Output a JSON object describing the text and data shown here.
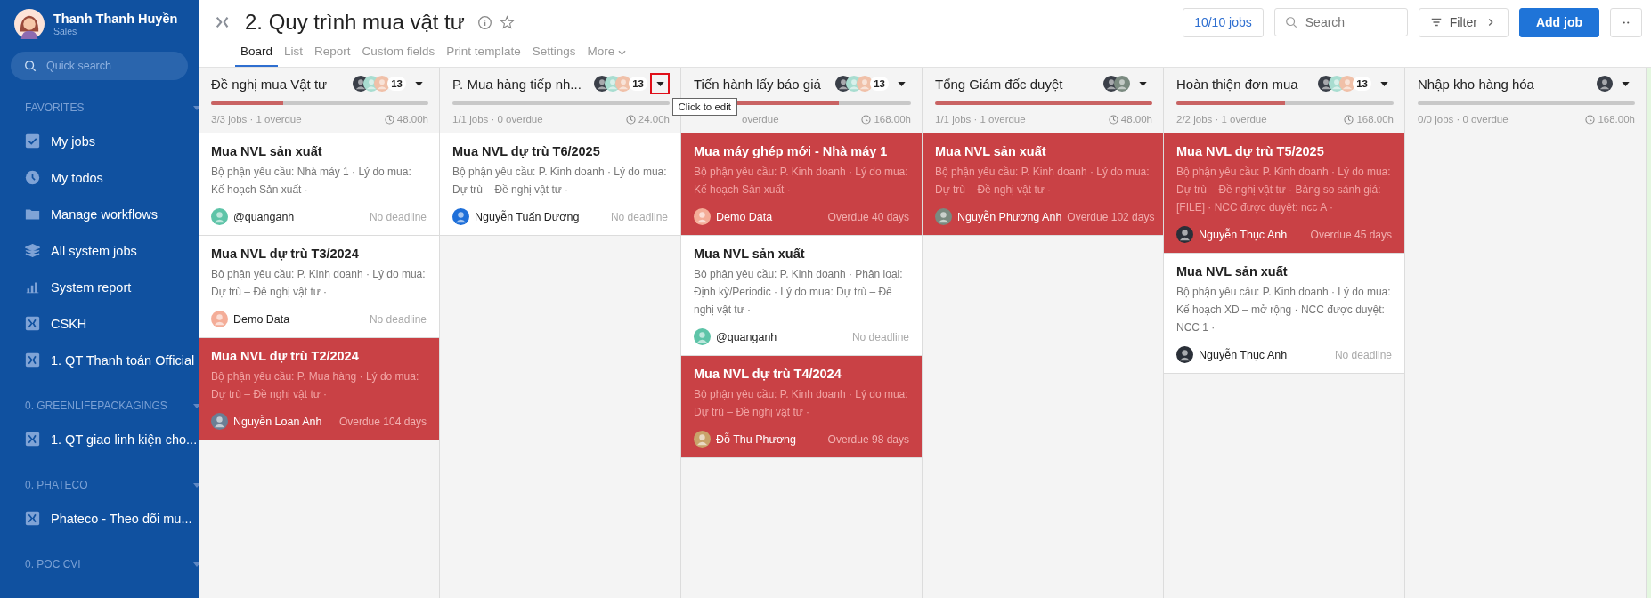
{
  "user": {
    "name": "Thanh Thanh Huyền",
    "role": "Sales"
  },
  "sidebar": {
    "search_placeholder": "Quick search",
    "sections": [
      {
        "title": "FAVORITES",
        "items": [
          {
            "label": "My jobs",
            "kind": "check"
          },
          {
            "label": "My todos",
            "kind": "clock"
          },
          {
            "label": "Manage workflows",
            "kind": "folder"
          },
          {
            "label": "All system jobs",
            "kind": "layers"
          },
          {
            "label": "System report",
            "kind": "chart"
          },
          {
            "label": "CSKH",
            "kind": "workflow"
          },
          {
            "label": "1. QT Thanh toán Official",
            "kind": "workflow"
          }
        ]
      },
      {
        "title": "0. GREENLIFEPACKAGINGS",
        "items": [
          {
            "label": "1. QT giao linh kiện cho...",
            "kind": "workflow"
          }
        ]
      },
      {
        "title": "0. PHATECO",
        "items": [
          {
            "label": "Phateco - Theo dõi mu...",
            "kind": "workflow"
          }
        ]
      },
      {
        "title": "0. POC CVI"
      }
    ]
  },
  "header": {
    "title": "2. Quy trình mua vật tư",
    "tabs": [
      {
        "label": "Board",
        "selected": true
      },
      {
        "label": "List",
        "selected": false
      },
      {
        "label": "Report",
        "selected": false
      },
      {
        "label": "Custom fields",
        "selected": false
      },
      {
        "label": "Print template",
        "selected": false
      },
      {
        "label": "Settings",
        "selected": false
      },
      {
        "label": "More",
        "selected": false
      }
    ],
    "job_count": "10/10 jobs",
    "search_placeholder": "Search",
    "filter": "Filter",
    "add": "Add job"
  },
  "tooltip": "Click to edit",
  "columns": [
    {
      "title": "Đề nghị mua Vật tư",
      "members": [
        {
          "color": "#3a3f48"
        },
        {
          "color": "#a8ddd0"
        },
        {
          "color": "#f0c0a8"
        }
      ],
      "count": "13",
      "highlighted": false,
      "level": 0.33,
      "stats": "3/3 jobs · 1 overdue",
      "hours": "48.00h",
      "cards": [
        {
          "title": "Mua NVL sản xuất",
          "desc": "Bộ phận yêu cầu: Nhà máy 1 · Lý do mua: Kế hoạch Sản xuất ·",
          "assignee": "@quanganh",
          "color": "#5ec4a8",
          "due": "No deadline",
          "overdue": false
        },
        {
          "title": "Mua NVL dự trù T3/2024",
          "desc": "Bộ phận yêu cầu: P. Kinh doanh · Lý do mua: Dự trù – Đề nghị vật tư ·",
          "assignee": "Demo Data",
          "color": "#f4ad98",
          "due": "No deadline",
          "overdue": false
        },
        {
          "title": "Mua NVL dự trù T2/2024",
          "desc": "Bộ phận yêu cầu: P. Mua hàng · Lý do mua: Dự trù – Đề nghị vật tư ·",
          "assignee": "Nguyễn Loan Anh",
          "color": "#6b7f95",
          "due": "Overdue 104 days",
          "overdue": true
        }
      ]
    },
    {
      "title": "P. Mua hàng tiếp nh...",
      "members": [
        {
          "color": "#3a3f48"
        },
        {
          "color": "#a8ddd0"
        },
        {
          "color": "#f0c0a8"
        }
      ],
      "count": "13",
      "highlighted": true,
      "stats": "1/1 jobs · 0 overdue",
      "hours": "24.00h",
      "cards": [
        {
          "title": "Mua NVL dự trù T6/2025",
          "desc": "Bộ phận yêu cầu: P. Kinh doanh · Lý do mua: Dự trù – Đề nghị vật tư ·",
          "assignee": "Nguyễn Tuấn Dương",
          "color": "#1e6fd9",
          "due": "No deadline",
          "overdue": false
        }
      ]
    },
    {
      "title": "Tiến hành lấy báo giá",
      "members": [
        {
          "color": "#3a3f48"
        },
        {
          "color": "#a8ddd0"
        },
        {
          "color": "#f0c0a8"
        }
      ],
      "count": "13",
      "highlighted": false,
      "level": 0.67,
      "stats": "overdue",
      "hours": "168.00h",
      "cards": [
        {
          "title": "Mua máy ghép mới - Nhà máy 1",
          "desc": "Bộ phận yêu cầu: P. Kinh doanh · Lý do mua: Kế hoạch Sản xuất ·",
          "assignee": "Demo Data",
          "color": "#f4ad98",
          "due": "Overdue 40 days",
          "overdue": true
        },
        {
          "title": "Mua NVL sản xuất",
          "desc": "Bộ phận yêu cầu: P. Kinh doanh · Phân loại: Định kỳ/Periodic · Lý do mua: Dự trù – Đề nghị vật tư ·",
          "assignee": "@quanganh",
          "color": "#5ec4a8",
          "due": "No deadline",
          "overdue": false
        },
        {
          "title": "Mua NVL dự trù T4/2024",
          "desc": "Bộ phận yêu cầu: P. Kinh doanh · Lý do mua: Dự trù – Đề nghị vật tư ·",
          "assignee": "Đỗ Thu Phương",
          "color": "#c9a36a",
          "due": "Overdue 98 days",
          "overdue": true
        }
      ]
    },
    {
      "title": "Tổng Giám đốc duyệt",
      "members": [
        {
          "color": "#3a3f48"
        },
        {
          "color": "#7a8a80"
        }
      ],
      "highlighted": false,
      "level": 1,
      "stats": "1/1 jobs · 1 overdue",
      "hours": "48.00h",
      "cards": [
        {
          "title": "Mua NVL sản xuất",
          "desc": "Bộ phận yêu cầu: P. Kinh doanh · Lý do mua: Dự trù – Đề nghị vật tư ·",
          "assignee": "Nguyễn Phương Anh",
          "color": "#7a8a80",
          "due": "Overdue 102 days",
          "overdue": true
        }
      ]
    },
    {
      "title": "Hoàn thiện đơn mua",
      "members": [
        {
          "color": "#3a3f48"
        },
        {
          "color": "#a8ddd0"
        },
        {
          "color": "#f0c0a8"
        }
      ],
      "count": "13",
      "highlighted": false,
      "level": 0.5,
      "stats": "2/2 jobs · 1 overdue",
      "hours": "168.00h",
      "cards": [
        {
          "title": "Mua NVL dự trù T5/2025",
          "desc": "Bộ phận yêu cầu: P. Kinh doanh · Lý do mua: Dự trù – Đề nghị vật tư · Bảng so sánh giá: [FILE] · NCC được duyệt: ncc A ·",
          "assignee": "Nguyễn Thục Anh",
          "color": "#2a2f38",
          "due": "Overdue 45 days",
          "overdue": true
        },
        {
          "title": "Mua NVL sản xuất",
          "desc": "Bộ phận yêu cầu: P. Kinh doanh · Lý do mua: Kế hoạch XD – mở rộng · NCC được duyệt: NCC 1 ·",
          "assignee": "Nguyễn Thục Anh",
          "color": "#2a2f38",
          "due": "No deadline",
          "overdue": false
        }
      ]
    },
    {
      "title": "Nhập kho hàng hóa",
      "members": [
        {
          "color": "#3a3f48"
        }
      ],
      "highlighted": false,
      "stats": "0/0 jobs · 0 overdue",
      "hours": "168.00h"
    }
  ]
}
